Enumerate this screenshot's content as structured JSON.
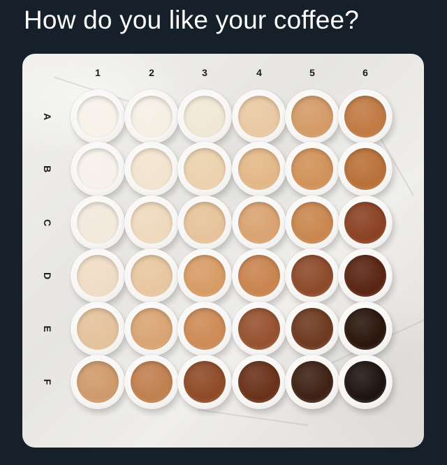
{
  "tweet": {
    "question": "How do you like your coffee?"
  },
  "grid": {
    "columns": [
      "1",
      "2",
      "3",
      "4",
      "5",
      "6"
    ],
    "rows": [
      "A",
      "B",
      "C",
      "D",
      "E",
      "F"
    ],
    "colors": [
      [
        "#f7f2ea",
        "#f5efe4",
        "#f1e7d5",
        "#e9c9a3",
        "#d49b67",
        "#c07a44"
      ],
      [
        "#f6f1ea",
        "#f2e4cf",
        "#ecd2ae",
        "#e3b888",
        "#d1925a",
        "#b9713a"
      ],
      [
        "#f3e9dc",
        "#efd9bd",
        "#e6c39a",
        "#d9a371",
        "#c9874f",
        "#8a4223"
      ],
      [
        "#efdcc5",
        "#e8c7a0",
        "#d79c66",
        "#c98450",
        "#8d4a2a",
        "#5a2513"
      ],
      [
        "#e4c29c",
        "#d9a473",
        "#cd8b57",
        "#96522f",
        "#6e3a20",
        "#2a170d"
      ],
      [
        "#cf9a6b",
        "#c0804f",
        "#8f4b27",
        "#6a321a",
        "#3f2214",
        "#1f1410"
      ]
    ]
  }
}
